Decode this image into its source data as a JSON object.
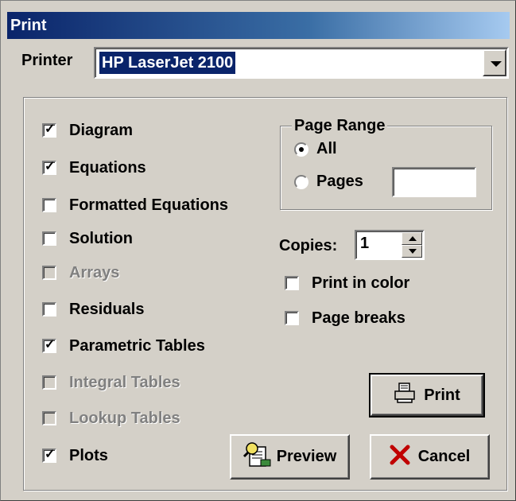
{
  "window": {
    "title": "Print"
  },
  "printer": {
    "label": "Printer",
    "selected": "HP LaserJet 2100"
  },
  "options": [
    {
      "label": "Diagram",
      "checked": true,
      "enabled": true
    },
    {
      "label": "Equations",
      "checked": true,
      "enabled": true
    },
    {
      "label": "Formatted Equations",
      "checked": false,
      "enabled": true
    },
    {
      "label": "Solution",
      "checked": false,
      "enabled": true
    },
    {
      "label": "Arrays",
      "checked": false,
      "enabled": false
    },
    {
      "label": "Residuals",
      "checked": false,
      "enabled": true
    },
    {
      "label": "Parametric Tables",
      "checked": true,
      "enabled": true
    },
    {
      "label": "Integral Tables",
      "checked": false,
      "enabled": false
    },
    {
      "label": "Lookup Tables",
      "checked": false,
      "enabled": false
    },
    {
      "label": "Plots",
      "checked": true,
      "enabled": true
    }
  ],
  "page_range": {
    "title": "Page Range",
    "all_label": "All",
    "pages_label": "Pages",
    "pages_value": "",
    "selected": "All"
  },
  "copies": {
    "label": "Copies:",
    "value": "1"
  },
  "print_in_color": {
    "label": "Print in color",
    "checked": false
  },
  "page_breaks": {
    "label": "Page breaks",
    "checked": false
  },
  "buttons": {
    "print": "Print",
    "preview": "Preview",
    "cancel": "Cancel"
  },
  "icons": {
    "print": "printer-icon",
    "preview": "preview-icon",
    "cancel": "cancel-x-icon",
    "dropdown": "chevron-down-icon"
  },
  "colors": {
    "title_bar": "#0a246a",
    "face": "#d4d0c8",
    "cancel_x": "#c00000"
  }
}
